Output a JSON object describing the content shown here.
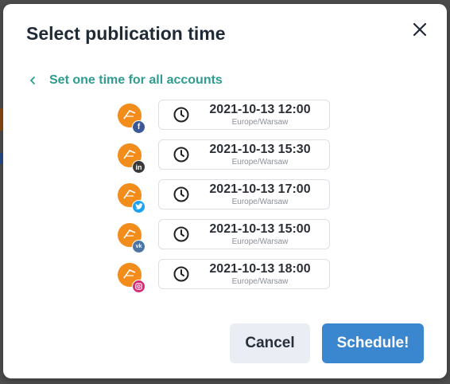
{
  "modal": {
    "title": "Select publication time",
    "back_link": "Set one time for all accounts",
    "cancel_label": "Cancel",
    "schedule_label": "Schedule!"
  },
  "accounts": [
    {
      "network": "facebook",
      "badge_icon": "facebook-icon",
      "datetime": "2021-10-13 12:00",
      "timezone": "Europe/Warsaw"
    },
    {
      "network": "linkedin",
      "badge_icon": "linkedin-icon",
      "datetime": "2021-10-13 15:30",
      "timezone": "Europe/Warsaw"
    },
    {
      "network": "twitter",
      "badge_icon": "twitter-icon",
      "datetime": "2021-10-13 17:00",
      "timezone": "Europe/Warsaw"
    },
    {
      "network": "vk",
      "badge_icon": "vk-icon",
      "datetime": "2021-10-13 15:00",
      "timezone": "Europe/Warsaw"
    },
    {
      "network": "instagram",
      "badge_icon": "instagram-icon",
      "datetime": "2021-10-13 18:00",
      "timezone": "Europe/Warsaw"
    }
  ],
  "colors": {
    "accent_teal": "#2e9c8f",
    "primary_blue": "#3a86cf",
    "avatar_orange": "#f28c1b",
    "overlay": "#4d4d4d"
  }
}
